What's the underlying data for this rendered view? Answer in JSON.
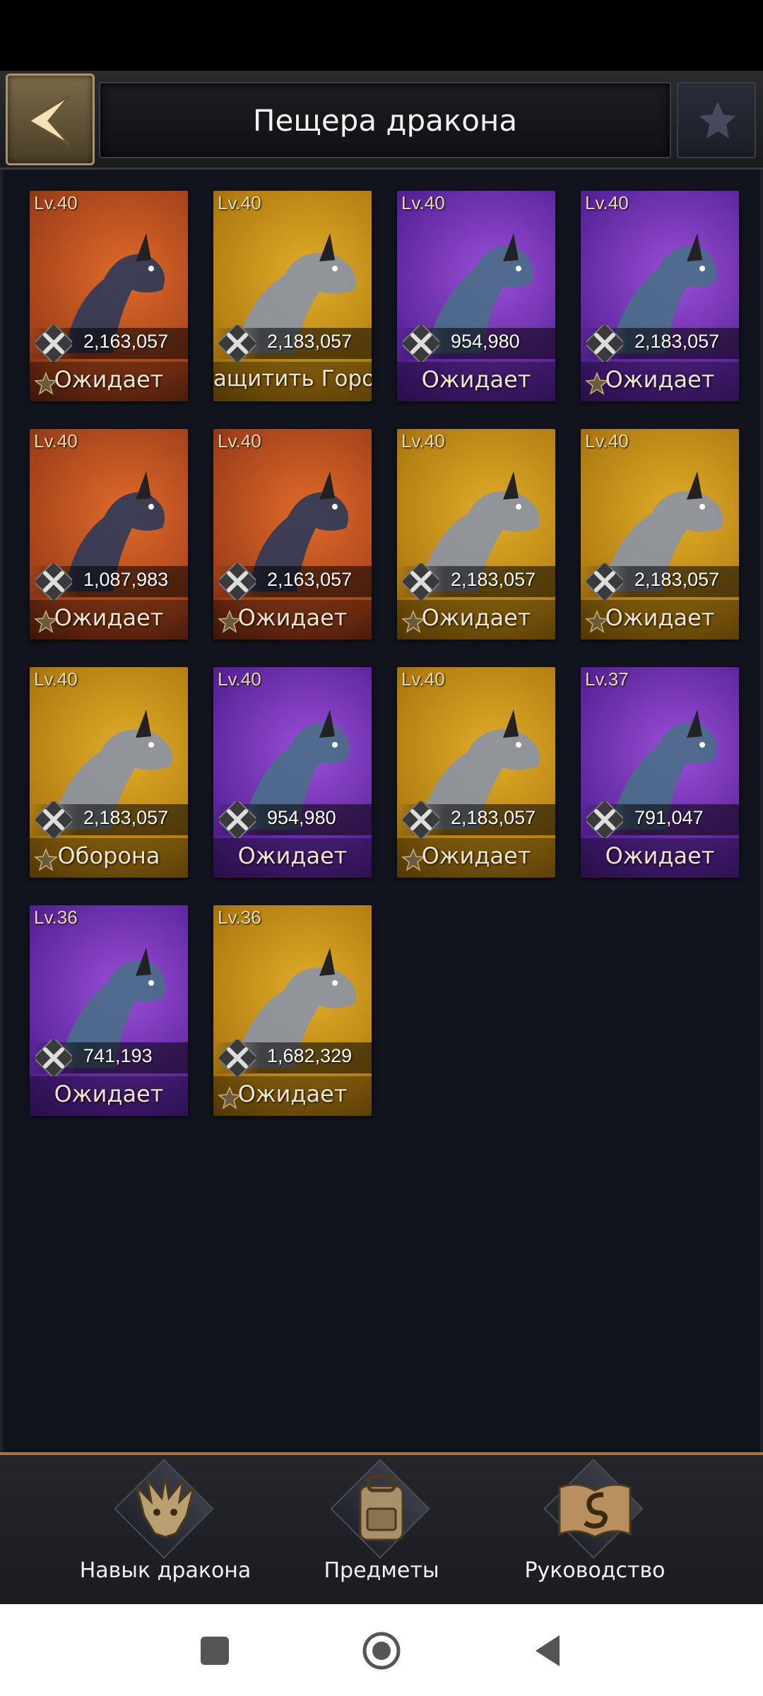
{
  "header": {
    "title": "Пещера дракона"
  },
  "dragons": [
    {
      "level": "Lv.40",
      "power": "2,163,057",
      "status": "Ожидает",
      "rarity": "orange",
      "starred": true
    },
    {
      "level": "Lv.40",
      "power": "2,183,057",
      "status": "Защитить Город",
      "rarity": "gold",
      "starred": false
    },
    {
      "level": "Lv.40",
      "power": "954,980",
      "status": "Ожидает",
      "rarity": "purple",
      "starred": false
    },
    {
      "level": "Lv.40",
      "power": "2,183,057",
      "status": "Ожидает",
      "rarity": "purple",
      "starred": true
    },
    {
      "level": "Lv.40",
      "power": "1,087,983",
      "status": "Ожидает",
      "rarity": "orange",
      "starred": true
    },
    {
      "level": "Lv.40",
      "power": "2,163,057",
      "status": "Ожидает",
      "rarity": "orange",
      "starred": true
    },
    {
      "level": "Lv.40",
      "power": "2,183,057",
      "status": "Ожидает",
      "rarity": "gold",
      "starred": true
    },
    {
      "level": "Lv.40",
      "power": "2,183,057",
      "status": "Ожидает",
      "rarity": "gold",
      "starred": true
    },
    {
      "level": "Lv.40",
      "power": "2,183,057",
      "status": "Оборона",
      "rarity": "gold",
      "starred": true
    },
    {
      "level": "Lv.40",
      "power": "954,980",
      "status": "Ожидает",
      "rarity": "purple",
      "starred": false
    },
    {
      "level": "Lv.40",
      "power": "2,183,057",
      "status": "Ожидает",
      "rarity": "gold",
      "starred": true
    },
    {
      "level": "Lv.37",
      "power": "791,047",
      "status": "Ожидает",
      "rarity": "purple",
      "starred": false
    },
    {
      "level": "Lv.36",
      "power": "741,193",
      "status": "Ожидает",
      "rarity": "purple",
      "starred": false
    },
    {
      "level": "Lv.36",
      "power": "1,682,329",
      "status": "Ожидает",
      "rarity": "gold",
      "starred": true
    }
  ],
  "bottom_nav": {
    "skill_label": "Навык дракона",
    "items_label": "Предметы",
    "guide_label": "Руководство"
  },
  "colors": {
    "purple": "#6a2cae",
    "gold": "#b8840f",
    "orange": "#b2491c",
    "accent_border": "#a07a3a"
  },
  "icons": {
    "back": "back-arrow-icon",
    "power": "crossed-swords-icon",
    "star": "star-icon",
    "skill": "dragon-head-icon",
    "items": "backpack-icon",
    "guide": "dragon-book-icon"
  }
}
